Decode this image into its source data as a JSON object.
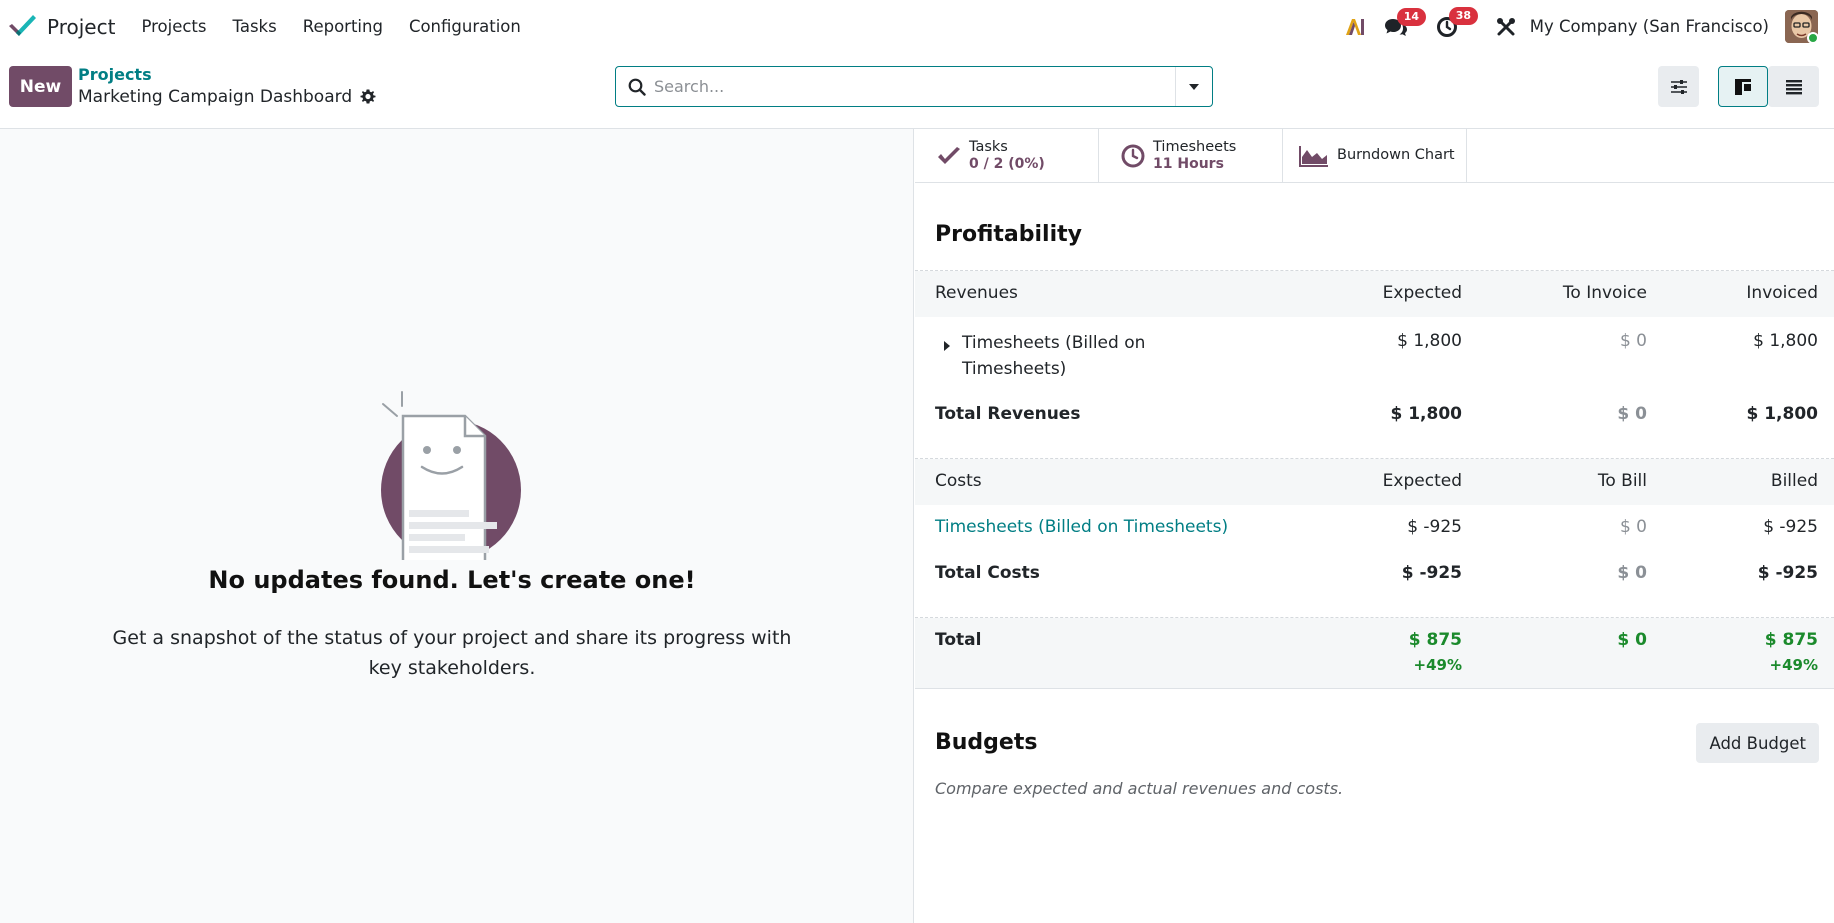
{
  "navbar": {
    "app_name": "Project",
    "menu": [
      "Projects",
      "Tasks",
      "Reporting",
      "Configuration"
    ],
    "messages_count": "14",
    "activities_count": "38",
    "company": "My Company (San Francisco)"
  },
  "control_panel": {
    "new_label": "New",
    "breadcrumb_parent": "Projects",
    "breadcrumb_current": "Marketing Campaign Dashboard",
    "search_placeholder": "Search..."
  },
  "empty_state": {
    "title": "No updates found. Let's create one!",
    "text": "Get a snapshot of the status of your project and share its progress with key stakeholders."
  },
  "stats": [
    {
      "label": "Tasks",
      "value": "0 / 2 (0%)"
    },
    {
      "label": "Timesheets",
      "value": "11 Hours"
    },
    {
      "label": "Burndown Chart"
    }
  ],
  "profitability": {
    "title": "Profitability",
    "revenues_header": [
      "Revenues",
      "Expected",
      "To Invoice",
      "Invoiced"
    ],
    "revenue_rows": [
      {
        "name": "Timesheets (Billed on Timesheets)",
        "expected": "$ 1,800",
        "to_invoice": "$ 0",
        "invoiced": "$ 1,800"
      }
    ],
    "total_revenues": {
      "name": "Total Revenues",
      "expected": "$ 1,800",
      "to_invoice": "$ 0",
      "invoiced": "$ 1,800"
    },
    "costs_header": [
      "Costs",
      "Expected",
      "To Bill",
      "Billed"
    ],
    "cost_rows": [
      {
        "name": "Timesheets (Billed on Timesheets)",
        "expected": "$ -925",
        "to_bill": "$ 0",
        "billed": "$ -925"
      }
    ],
    "total_costs": {
      "name": "Total Costs",
      "expected": "$ -925",
      "to_bill": "$ 0",
      "billed": "$ -925"
    },
    "total": {
      "name": "Total",
      "expected": "$ 875",
      "expected_pct": "+49%",
      "to_bill": "$ 0",
      "billed": "$ 875",
      "billed_pct": "+49%"
    }
  },
  "budgets": {
    "title": "Budgets",
    "add_label": "Add Budget",
    "help": "Compare expected and actual revenues and costs."
  },
  "colors": {
    "primary": "#714b67",
    "link": "#017e84",
    "positive": "#1b8a2c",
    "badge": "#d9313e"
  }
}
